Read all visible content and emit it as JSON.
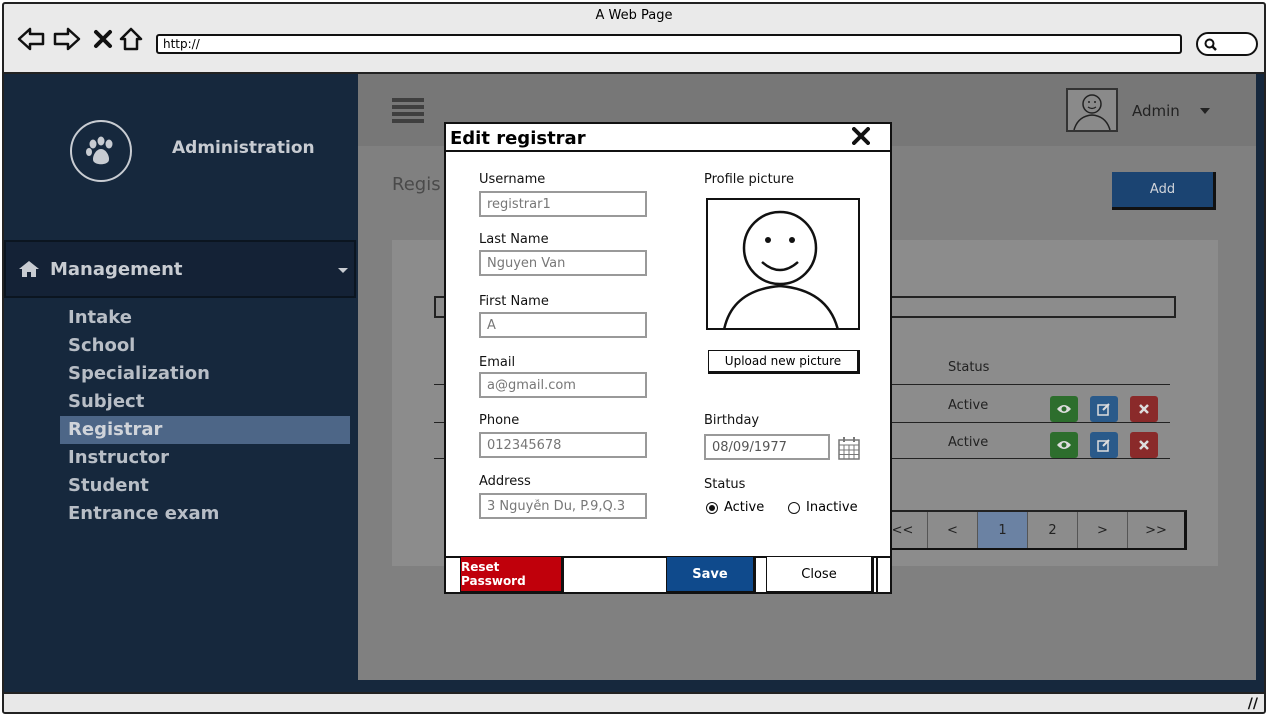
{
  "browser": {
    "title": "A Web Page",
    "url": "http://"
  },
  "sidebar": {
    "brand": "Administration",
    "section_label": "Management",
    "items": [
      {
        "label": "Intake",
        "active": false
      },
      {
        "label": "School",
        "active": false
      },
      {
        "label": "Specialization",
        "active": false
      },
      {
        "label": "Subject",
        "active": false
      },
      {
        "label": "Registrar",
        "active": true
      },
      {
        "label": "Instructor",
        "active": false
      },
      {
        "label": "Student",
        "active": false
      },
      {
        "label": "Entrance exam",
        "active": false
      }
    ]
  },
  "header": {
    "user_name": "Admin"
  },
  "content": {
    "title_partial": "Regis",
    "add_label": "Add",
    "table": {
      "status_header": "Status",
      "rows": [
        {
          "status": "Active"
        },
        {
          "status": "Active"
        }
      ]
    },
    "pagination": [
      "<<",
      "<",
      "1",
      "2",
      ">",
      ">>"
    ],
    "current_page": "1"
  },
  "modal": {
    "title": "Edit registrar",
    "fields": {
      "username": {
        "label": "Username",
        "value": "registrar1"
      },
      "last_name": {
        "label": "Last Name",
        "value": "Nguyen Van"
      },
      "first_name": {
        "label": "First Name",
        "value": "A"
      },
      "email": {
        "label": "Email",
        "value": "a@gmail.com"
      },
      "phone": {
        "label": "Phone",
        "value": "012345678"
      },
      "address": {
        "label": "Address",
        "value": "3 Nguyễn Du, P.9,Q.3"
      },
      "birthday": {
        "label": "Birthday",
        "value": "08/09/1977"
      }
    },
    "profile_picture_label": "Profile picture",
    "upload_label": "Upload new picture",
    "status": {
      "label": "Status",
      "options": [
        "Active",
        "Inactive"
      ],
      "selected": "Active"
    },
    "buttons": {
      "reset": "Reset Password",
      "save": "Save",
      "close": "Close"
    }
  },
  "colors": {
    "sidebar_bg": "#16283d",
    "active_item": "#4d6687",
    "overlay": "#808080",
    "reset_red": "#c0000b",
    "save_blue": "#0f4a8c"
  }
}
